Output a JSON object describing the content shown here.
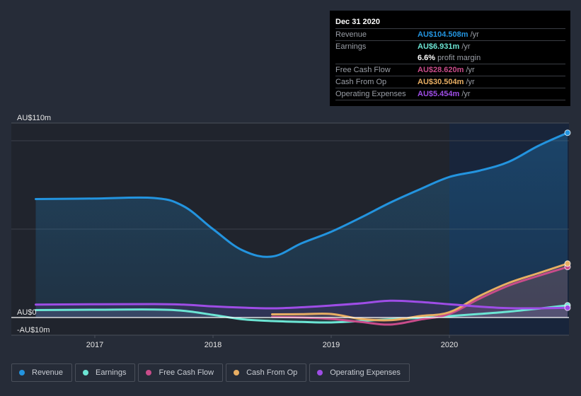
{
  "tooltip": {
    "date": "Dec 31 2020",
    "rows": [
      {
        "label": "Revenue",
        "value": "AU$104.508m",
        "unit": "/yr",
        "color": "#2394df"
      },
      {
        "label": "Earnings",
        "value": "AU$6.931m",
        "unit": "/yr",
        "color": "#6ce5d4"
      },
      {
        "label": "",
        "value": "6.6%",
        "unit": "profit margin",
        "color": "#ffffff"
      },
      {
        "label": "Free Cash Flow",
        "value": "AU$28.620m",
        "unit": "/yr",
        "color": "#c94c8a"
      },
      {
        "label": "Cash From Op",
        "value": "AU$30.504m",
        "unit": "/yr",
        "color": "#e8ae63"
      },
      {
        "label": "Operating Expenses",
        "value": "AU$5.454m",
        "unit": "/yr",
        "color": "#9e4de6"
      }
    ]
  },
  "legend": [
    {
      "label": "Revenue",
      "color": "#2394df"
    },
    {
      "label": "Earnings",
      "color": "#6ce5d4"
    },
    {
      "label": "Free Cash Flow",
      "color": "#c94c8a"
    },
    {
      "label": "Cash From Op",
      "color": "#e8ae63"
    },
    {
      "label": "Operating Expenses",
      "color": "#9e4de6"
    }
  ],
  "chart_data": {
    "type": "line",
    "title": "",
    "xlabel": "",
    "ylabel": "",
    "ylim": [
      -10,
      110
    ],
    "xlim": [
      2016.0,
      2021.0
    ],
    "y_tick_labels": [
      {
        "value": 110,
        "label": "AU$110m"
      },
      {
        "value": 0,
        "label": "AU$0"
      },
      {
        "value": -10,
        "label": "-AU$10m"
      }
    ],
    "gridlines": [
      100,
      50
    ],
    "x_tick_labels": [
      {
        "value": 2017,
        "label": "2017"
      },
      {
        "value": 2018,
        "label": "2018"
      },
      {
        "value": 2019,
        "label": "2019"
      },
      {
        "value": 2020,
        "label": "2020"
      }
    ],
    "highlight_from": 2020.0,
    "legend_position": "bottom-left",
    "series": [
      {
        "name": "Revenue",
        "color": "#2394df",
        "x": [
          2016.5,
          2017.0,
          2017.5,
          2017.75,
          2018.0,
          2018.25,
          2018.5,
          2018.75,
          2019.0,
          2019.25,
          2019.5,
          2019.75,
          2020.0,
          2020.25,
          2020.5,
          2020.75,
          2021.0
        ],
        "y": [
          67,
          67.3,
          67.6,
          63,
          50,
          38,
          34.5,
          42,
          48.5,
          56.5,
          65,
          72.5,
          79.5,
          83,
          88,
          97,
          104.5
        ]
      },
      {
        "name": "Earnings",
        "color": "#6ce5d4",
        "x": [
          2016.5,
          2017.0,
          2017.5,
          2017.75,
          2018.0,
          2018.25,
          2018.5,
          2018.75,
          2019.0,
          2019.25,
          2019.5,
          2019.75,
          2020.0,
          2020.25,
          2020.5,
          2020.75,
          2021.0
        ],
        "y": [
          4.2,
          4.4,
          4.5,
          3.8,
          1.5,
          -1.0,
          -2.0,
          -2.5,
          -2.8,
          -2.0,
          -1.0,
          -0.2,
          0.8,
          2.0,
          3.3,
          5.0,
          6.9
        ]
      },
      {
        "name": "Free Cash Flow",
        "color": "#c94c8a",
        "x": [
          2018.5,
          2018.75,
          2019.0,
          2019.25,
          2019.5,
          2019.75,
          2020.0,
          2020.25,
          2020.5,
          2020.75,
          2021.0
        ],
        "y": [
          0.3,
          0.0,
          -0.8,
          -2.5,
          -4.0,
          -1.2,
          2.0,
          10.5,
          18,
          23.5,
          28.6
        ]
      },
      {
        "name": "Cash From Op",
        "color": "#e8ae63",
        "x": [
          2018.5,
          2018.75,
          2019.0,
          2019.25,
          2019.5,
          2019.75,
          2020.0,
          2020.25,
          2020.5,
          2020.75,
          2021.0
        ],
        "y": [
          1.8,
          1.9,
          2.0,
          -0.8,
          -1.5,
          0.8,
          3.0,
          12.0,
          19.5,
          25.0,
          30.5
        ]
      },
      {
        "name": "Operating Expenses",
        "color": "#9e4de6",
        "x": [
          2016.5,
          2017.0,
          2017.5,
          2017.75,
          2018.0,
          2018.25,
          2018.5,
          2018.75,
          2019.0,
          2019.25,
          2019.5,
          2019.75,
          2020.0,
          2020.25,
          2020.5,
          2020.75,
          2021.0
        ],
        "y": [
          7.3,
          7.5,
          7.6,
          7.3,
          6.3,
          5.6,
          5.2,
          5.8,
          6.8,
          8.0,
          9.5,
          8.8,
          7.5,
          6.2,
          5.3,
          5.2,
          5.5
        ]
      }
    ]
  }
}
